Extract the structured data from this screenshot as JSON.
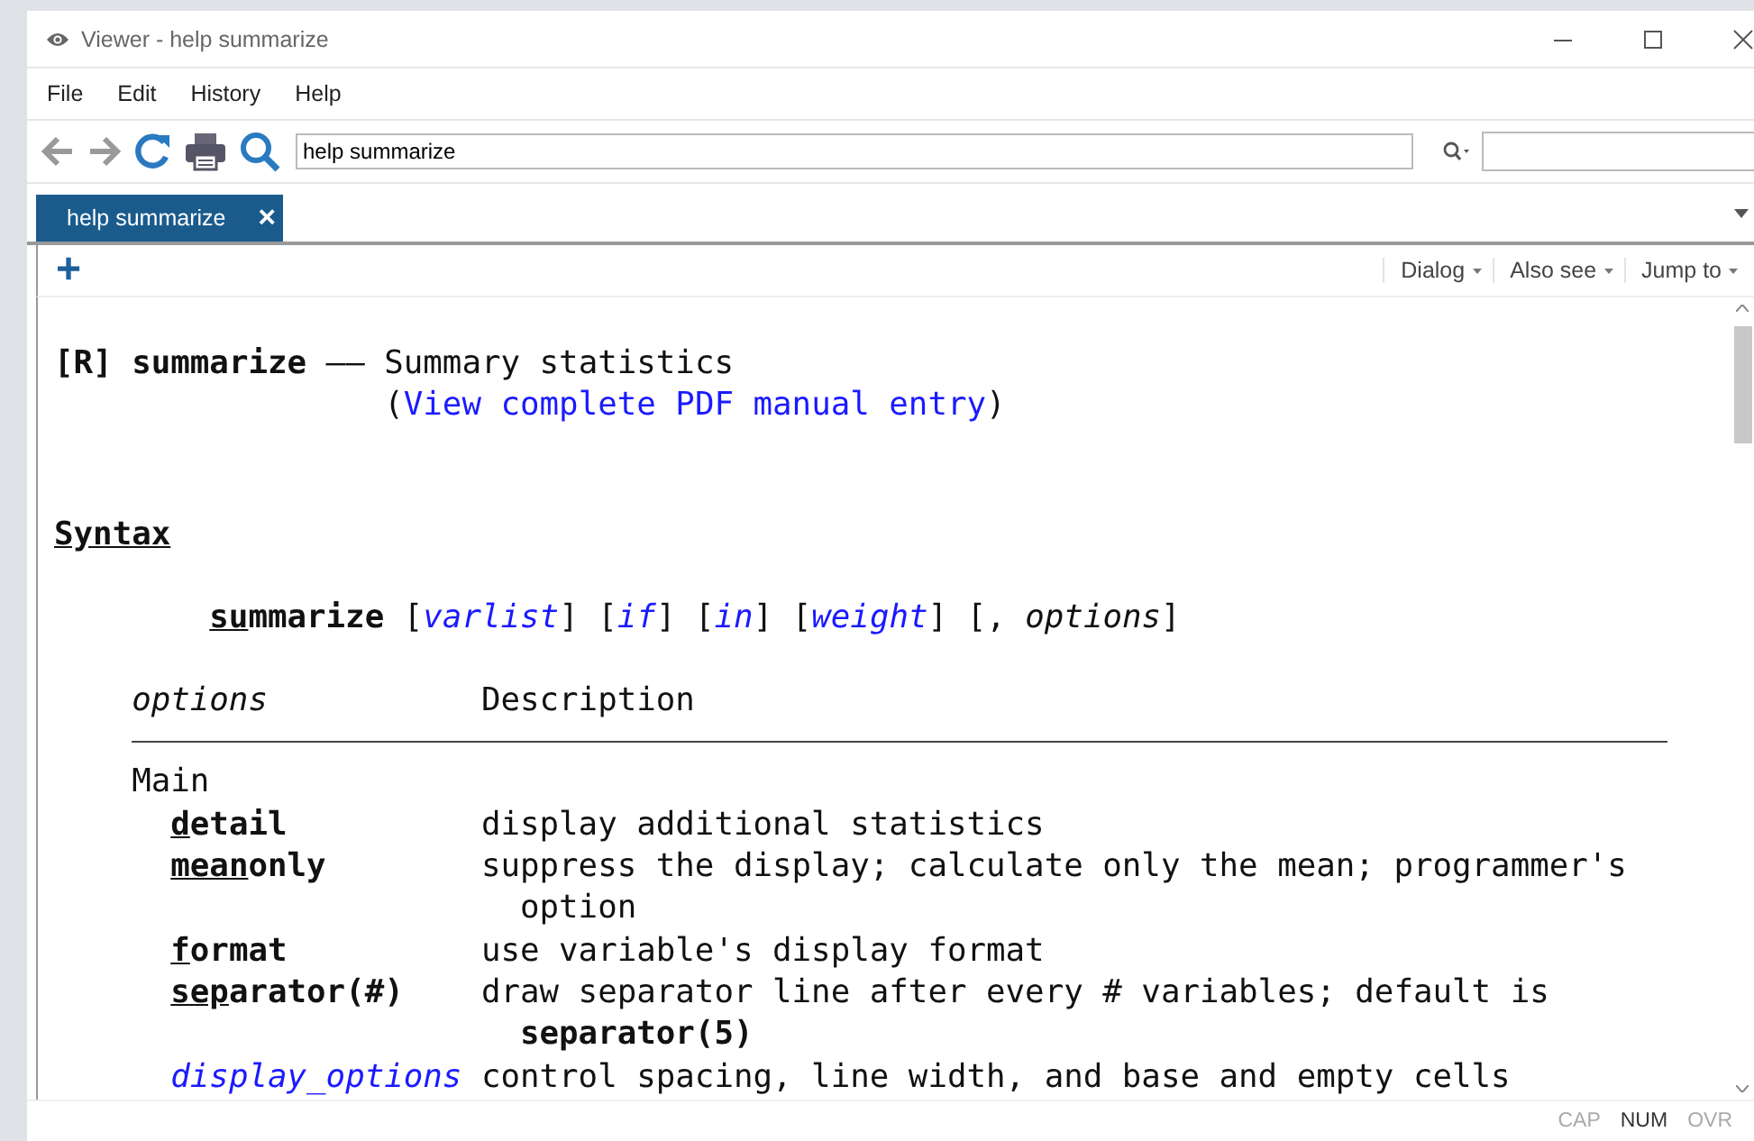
{
  "window": {
    "title": "Viewer - help summarize"
  },
  "menu": [
    "File",
    "Edit",
    "History",
    "Help"
  ],
  "toolbar": {
    "address": "help summarize"
  },
  "tabs": [
    {
      "label": "help summarize",
      "close": "×",
      "selected": true
    }
  ],
  "content_toolbar": {
    "add": "+",
    "menus": [
      "Dialog",
      "Also see",
      "Jump to"
    ]
  },
  "document": {
    "heading": {
      "entry": "[R] summarize",
      "dash": "——",
      "title": "Summary statistics"
    },
    "pdf_link": {
      "prefix": "(",
      "text": "View complete PDF manual entry",
      "suffix": ")"
    },
    "section": "Syntax",
    "syntax": [
      {
        "kind": "command",
        "abbrev": "su",
        "rest": "mmarize"
      },
      {
        "kind": "text",
        "text": " ["
      },
      {
        "kind": "link",
        "text": "varlist"
      },
      {
        "kind": "text",
        "text": "] ["
      },
      {
        "kind": "link",
        "text": "if"
      },
      {
        "kind": "text",
        "text": "] ["
      },
      {
        "kind": "link",
        "text": "in"
      },
      {
        "kind": "text",
        "text": "] ["
      },
      {
        "kind": "link",
        "text": "weight"
      },
      {
        "kind": "text",
        "text": "] [, "
      },
      {
        "kind": "italic",
        "text": "options"
      },
      {
        "kind": "text",
        "text": "]"
      }
    ],
    "table_header": {
      "column_1": "options",
      "column_2": "Description"
    },
    "group": "Main",
    "options": [
      {
        "kind": "command",
        "abbrev": "d",
        "rest": "etail",
        "lines": [
          {
            "kind": "plain",
            "text": "display additional statistics"
          }
        ]
      },
      {
        "kind": "command",
        "abbrev": "mean",
        "rest": "only",
        "lines": [
          {
            "kind": "plain",
            "text": "suppress the display; calculate only the mean; programmer's"
          },
          {
            "kind": "plain",
            "text": "option"
          }
        ]
      },
      {
        "kind": "command",
        "abbrev": "f",
        "rest": "ormat",
        "lines": [
          {
            "kind": "plain",
            "text": "use variable's display format"
          }
        ]
      },
      {
        "kind": "command",
        "abbrev": "sep",
        "rest": "arator(#)",
        "lines": [
          {
            "kind": "plain",
            "text": "draw separator line after every # variables; default is"
          },
          {
            "kind": "bold",
            "text": "separator(5)"
          }
        ]
      },
      {
        "kind": "link",
        "text": "display_options",
        "lines": [
          {
            "kind": "plain",
            "text": "control spacing, line width, and base and empty cells"
          }
        ]
      }
    ]
  },
  "status_bar": [
    {
      "text": "CAP",
      "on": false
    },
    {
      "text": "NUM",
      "on": true
    },
    {
      "text": "OVR",
      "on": false
    }
  ]
}
